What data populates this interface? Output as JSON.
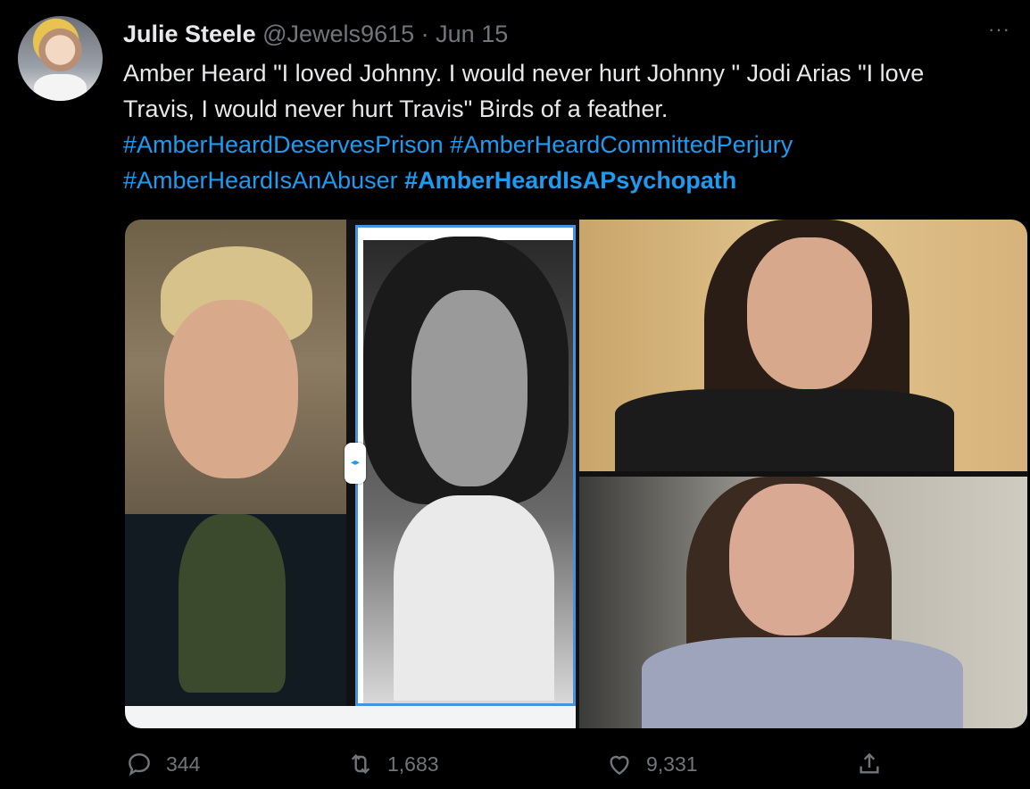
{
  "tweet": {
    "author_name": "Julie Steele",
    "author_handle": "@Jewels9615",
    "separator": "·",
    "date": "Jun 15",
    "more_label": "···",
    "text_line1": "Amber Heard \"I loved Johnny. I would never hurt Johnny \" Jodi Arias \"I love",
    "text_line2": "Travis, I would never hurt Travis\" Birds of a feather.",
    "hashtags": [
      "#AmberHeardDeservesPrison",
      "#AmberHeardCommittedPerjury",
      "#AmberHeardIsAnAbuser",
      "#AmberHeardIsAPsychopath"
    ],
    "media": {
      "panels": 4,
      "comparison_slider_icon": "left-right-arrows-icon"
    },
    "actions": {
      "replies": "344",
      "retweets": "1,683",
      "likes": "9,331"
    }
  },
  "icons": {
    "reply": "reply-icon",
    "retweet": "retweet-icon",
    "like": "heart-icon",
    "share": "share-icon"
  },
  "colors": {
    "background": "#000000",
    "text": "#e7e9ea",
    "muted": "#71767b",
    "link": "#1d9bf0"
  }
}
